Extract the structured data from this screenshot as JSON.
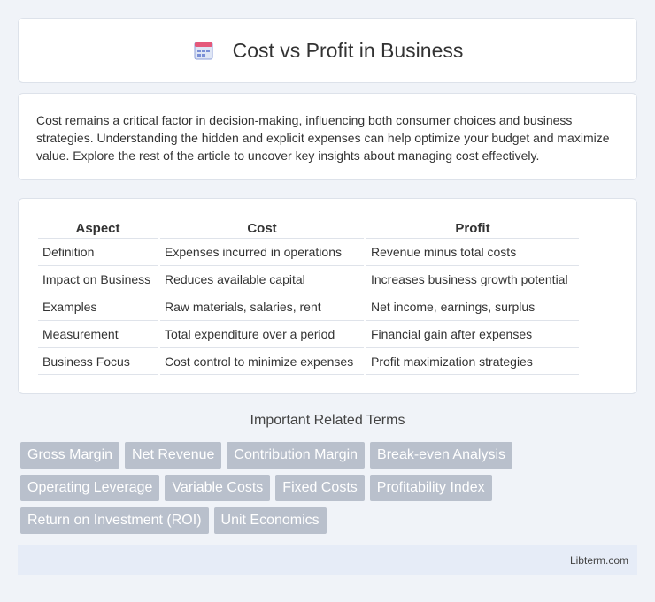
{
  "header": {
    "title": "Cost vs Profit in Business",
    "icon": "calendar-icon"
  },
  "intro": {
    "text": "Cost remains a critical factor in decision-making, influencing both consumer choices and business strategies. Understanding the hidden and explicit expenses can help optimize your budget and maximize value. Explore the rest of the article to uncover key insights about managing cost effectively."
  },
  "table": {
    "headers": [
      "Aspect",
      "Cost",
      "Profit"
    ],
    "rows": [
      [
        "Definition",
        "Expenses incurred in operations",
        "Revenue minus total costs"
      ],
      [
        "Impact on Business",
        "Reduces available capital",
        "Increases business growth potential"
      ],
      [
        "Examples",
        "Raw materials, salaries, rent",
        "Net income, earnings, surplus"
      ],
      [
        "Measurement",
        "Total expenditure over a period",
        "Financial gain after expenses"
      ],
      [
        "Business Focus",
        "Cost control to minimize expenses",
        "Profit maximization strategies"
      ]
    ]
  },
  "related": {
    "title": "Important Related Terms",
    "tags": [
      "Gross Margin",
      "Net Revenue",
      "Contribution Margin",
      "Break-even Analysis",
      "Operating Leverage",
      "Variable Costs",
      "Fixed Costs",
      "Profitability Index",
      "Return on Investment (ROI)",
      "Unit Economics"
    ]
  },
  "footer": {
    "site": "Libterm.com"
  },
  "colors": {
    "tag_bg": "#b9c0cc",
    "footer_bg": "#e6ecf7",
    "page_bg": "#f0f3f8"
  }
}
